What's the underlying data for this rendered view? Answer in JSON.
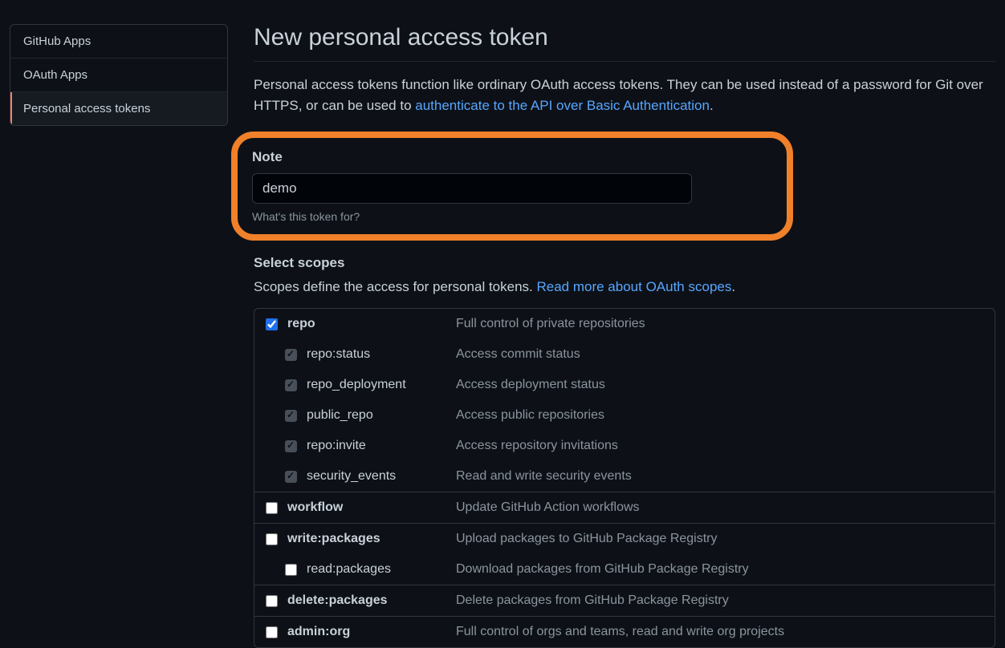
{
  "sidebar": {
    "items": [
      {
        "label": "GitHub Apps",
        "active": false
      },
      {
        "label": "OAuth Apps",
        "active": false
      },
      {
        "label": "Personal access tokens",
        "active": true
      }
    ]
  },
  "page": {
    "title": "New personal access token",
    "intro_prefix": "Personal access tokens function like ordinary OAuth access tokens. They can be used instead of a password for Git over HTTPS, or can be used to ",
    "intro_link": "authenticate to the API over Basic Authentication",
    "intro_suffix": "."
  },
  "note": {
    "label": "Note",
    "value": "demo",
    "hint": "What's this token for?"
  },
  "scopes": {
    "heading": "Select scopes",
    "intro_prefix": "Scopes define the access for personal tokens. ",
    "intro_link": "Read more about OAuth scopes",
    "intro_suffix": ".",
    "groups": [
      {
        "name": "repo",
        "desc": "Full control of private repositories",
        "checked": true,
        "children": [
          {
            "name": "repo:status",
            "desc": "Access commit status",
            "implied": true
          },
          {
            "name": "repo_deployment",
            "desc": "Access deployment status",
            "implied": true
          },
          {
            "name": "public_repo",
            "desc": "Access public repositories",
            "implied": true
          },
          {
            "name": "repo:invite",
            "desc": "Access repository invitations",
            "implied": true
          },
          {
            "name": "security_events",
            "desc": "Read and write security events",
            "implied": true
          }
        ]
      },
      {
        "name": "workflow",
        "desc": "Update GitHub Action workflows",
        "checked": false,
        "children": []
      },
      {
        "name": "write:packages",
        "desc": "Upload packages to GitHub Package Registry",
        "checked": false,
        "children": [
          {
            "name": "read:packages",
            "desc": "Download packages from GitHub Package Registry",
            "implied": false
          }
        ]
      },
      {
        "name": "delete:packages",
        "desc": "Delete packages from GitHub Package Registry",
        "checked": false,
        "children": []
      },
      {
        "name": "admin:org",
        "desc": "Full control of orgs and teams, read and write org projects",
        "checked": false,
        "children": []
      }
    ]
  }
}
